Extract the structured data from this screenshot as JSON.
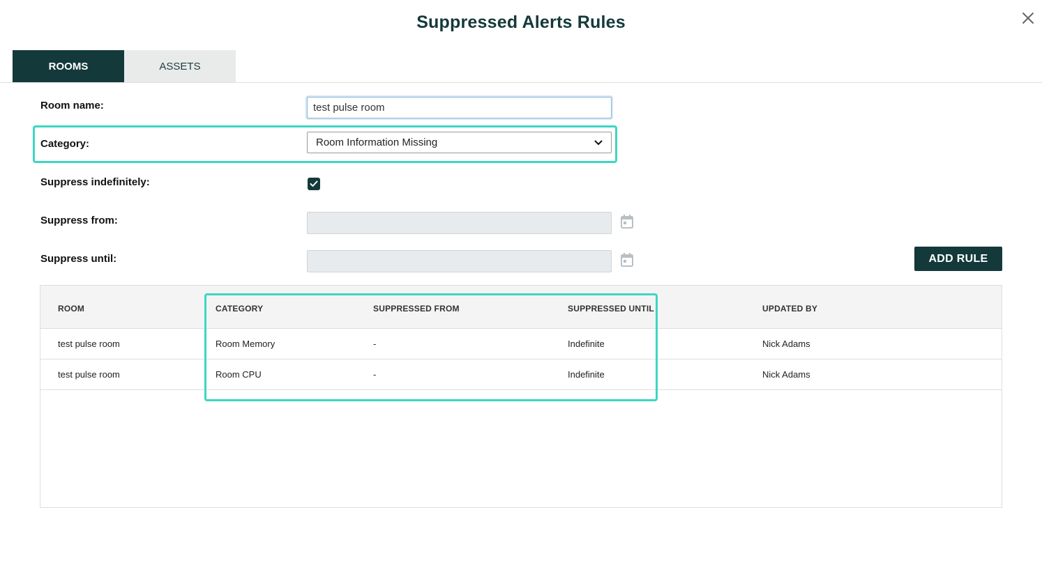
{
  "dialog": {
    "title": "Suppressed Alerts Rules"
  },
  "tabs": [
    {
      "label": "ROOMS",
      "active": true
    },
    {
      "label": "ASSETS",
      "active": false
    }
  ],
  "form": {
    "room_name_label": "Room name:",
    "room_name_value": "test pulse room",
    "category_label": "Category:",
    "category_value": "Room Information Missing",
    "suppress_indefinitely_label": "Suppress indefinitely:",
    "suppress_indefinitely_checked": true,
    "suppress_from_label": "Suppress from:",
    "suppress_until_label": "Suppress until:",
    "add_rule_label": "ADD RULE"
  },
  "table": {
    "columns": [
      "ROOM",
      "CATEGORY",
      "SUPPRESSED FROM",
      "SUPPRESSED UNTIL",
      "UPDATED BY"
    ],
    "rows": [
      [
        "test pulse room",
        "Room Memory",
        "-",
        "Indefinite",
        "Nick Adams"
      ],
      [
        "test pulse room",
        "Room CPU",
        "-",
        "Indefinite",
        "Nick Adams"
      ]
    ]
  },
  "icons": {
    "close": "close-icon",
    "dropdown": "chevron-down-icon",
    "check": "check-icon",
    "calendar": "calendar-icon"
  },
  "colors": {
    "primary": "#14393a",
    "highlight": "#3dd6c3",
    "tab_inactive": "#e9ebeb",
    "disabled_input": "#e8ebed"
  }
}
